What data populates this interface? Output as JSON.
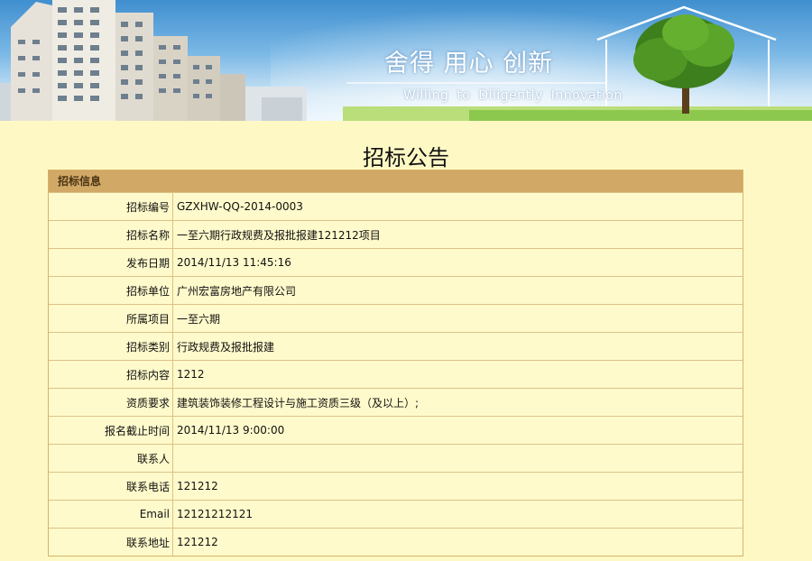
{
  "banner": {
    "slogan_cn": "舍得  用心  创新",
    "slogan_en": "Willing to  Diligently  Innovation"
  },
  "page": {
    "title": "招标公告"
  },
  "panel": {
    "header": "招标信息",
    "rows": [
      {
        "label": "招标编号",
        "value": "GZXHW-QQ-2014-0003"
      },
      {
        "label": "招标名称",
        "value": "一至六期行政规费及报批报建121212项目"
      },
      {
        "label": "发布日期",
        "value": "2014/11/13 11:45:16"
      },
      {
        "label": "招标单位",
        "value": "广州宏富房地产有限公司"
      },
      {
        "label": "所属项目",
        "value": "一至六期"
      },
      {
        "label": "招标类别",
        "value": "行政规费及报批报建"
      },
      {
        "label": "招标内容",
        "value": "1212"
      },
      {
        "label": "资质要求",
        "value": "建筑装饰装修工程设计与施工资质三级（及以上）;"
      },
      {
        "label": "报名截止时间",
        "value": "2014/11/13 9:00:00"
      },
      {
        "label": "联系人",
        "value": ""
      },
      {
        "label": "联系电话",
        "value": "121212"
      },
      {
        "label": "Email",
        "value": "12121212121"
      },
      {
        "label": "联系地址",
        "value": "121212"
      }
    ]
  },
  "colors": {
    "page_background": "#fef9c4",
    "panel_header": "#d1a866",
    "table_border": "#dcc287"
  }
}
